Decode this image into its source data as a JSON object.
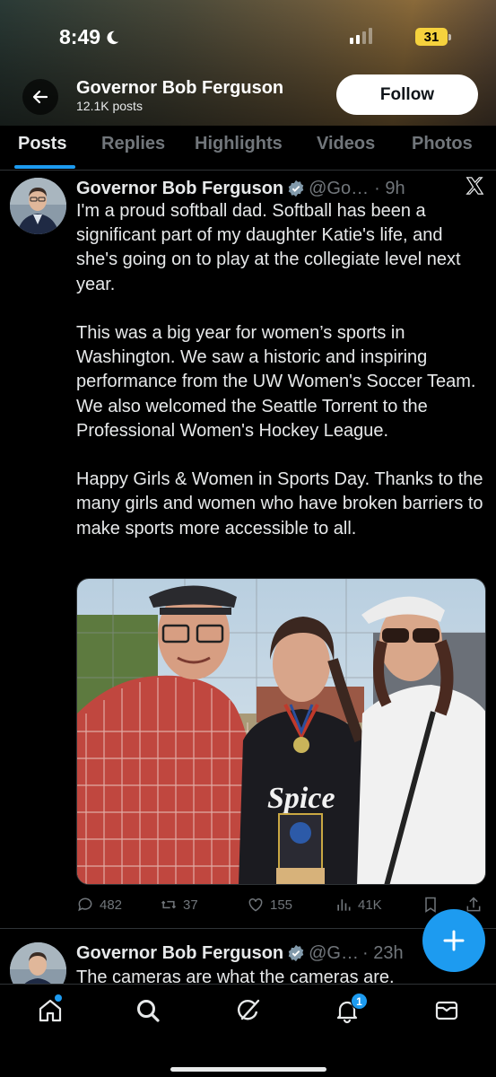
{
  "status_bar": {
    "time": "8:49",
    "battery": "31"
  },
  "profile": {
    "name": "Governor Bob Ferguson",
    "posts_count": "12.1K posts",
    "follow_label": "Follow"
  },
  "tabs": [
    {
      "label": "Posts",
      "active": true
    },
    {
      "label": "Replies"
    },
    {
      "label": "Highlights"
    },
    {
      "label": "Videos"
    },
    {
      "label": "Photos"
    }
  ],
  "tweet": {
    "author": "Governor Bob Ferguson",
    "handle": "@Go…",
    "time": "· 9h",
    "text": "I'm a proud softball dad. Softball has been a significant part of my daughter Katie's life, and she's going on to play at the collegiate level next year.\n\nThis was a big year for women’s sports in Washington. We saw a historic and inspiring performance from the UW Women's Soccer Team. We also welcomed the Seattle Torrent to the Professional Women's Hockey League.\n\nHappy Girls & Women in Sports Day. Thanks to the many girls and women who have broken barriers to make sports more accessible to all.",
    "photo_jersey_text": "Spice",
    "replies": "482",
    "reposts": "37",
    "likes": "155",
    "views": "41K"
  },
  "tweet2": {
    "author": "Governor Bob Ferguson",
    "handle": "@G…",
    "time": "· 23h",
    "text": "The cameras are what the cameras are."
  },
  "bottom_nav": {
    "notifications_badge": "1"
  },
  "colors": {
    "accent": "#1d9bf0",
    "background": "#000000",
    "text": "#e7e9ea",
    "muted": "#71767b",
    "battery": "#f6d23d"
  },
  "icons": [
    "back-arrow-icon",
    "verified-icon",
    "x-logo-icon",
    "reply-icon",
    "repost-icon",
    "like-icon",
    "views-icon",
    "bookmark-icon",
    "share-icon",
    "compose-plus-icon",
    "home-icon",
    "search-icon",
    "grok-icon",
    "notifications-icon",
    "messages-icon"
  ]
}
